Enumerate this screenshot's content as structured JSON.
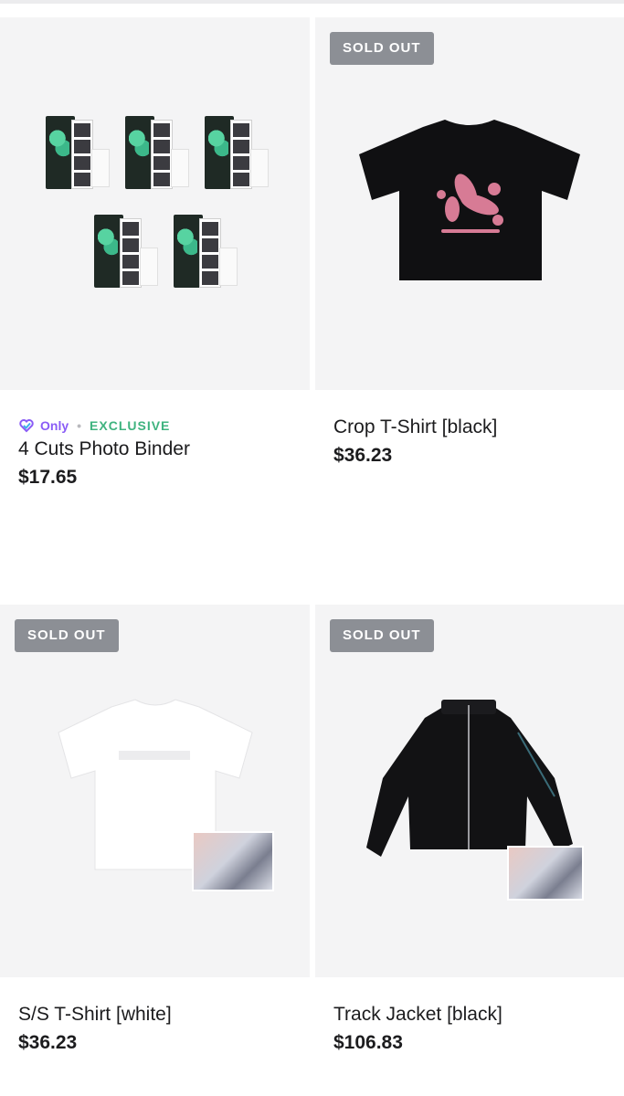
{
  "products": [
    {
      "sold_out": false,
      "sold_out_label": "",
      "only_label": "Only",
      "exclusive_label": "EXCLUSIVE",
      "name": "4 Cuts Photo Binder",
      "price": "$17.65"
    },
    {
      "sold_out": true,
      "sold_out_label": "SOLD OUT",
      "name": "Crop T-Shirt [black]",
      "price": "$36.23"
    },
    {
      "sold_out": true,
      "sold_out_label": "SOLD OUT",
      "name": "S/S T-Shirt [white]",
      "price": "$36.23"
    },
    {
      "sold_out": true,
      "sold_out_label": "SOLD OUT",
      "name": "Track Jacket [black]",
      "price": "$106.83"
    }
  ],
  "colors": {
    "sold_out_badge": "#8c8f95",
    "only_purple": "#8a5cf6",
    "exclusive_green": "#3fb37f",
    "thumb_bg": "#f4f4f5"
  },
  "icons": {
    "only_icon": "heart-badge-icon"
  }
}
